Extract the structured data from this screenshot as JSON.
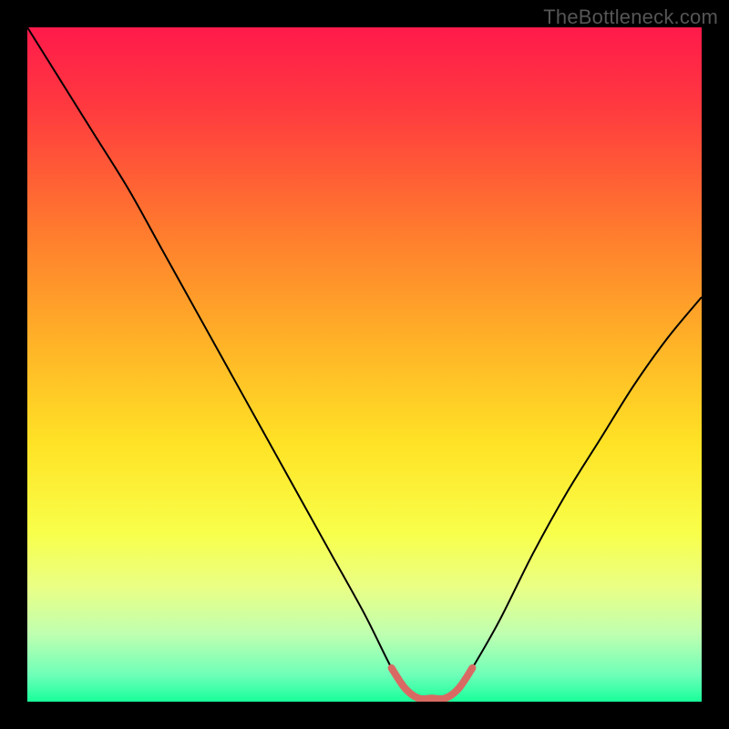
{
  "watermark": "TheBottleneck.com",
  "chart_data": {
    "type": "line",
    "title": "",
    "xlabel": "",
    "ylabel": "",
    "xlim": [
      0,
      100
    ],
    "ylim": [
      0,
      100
    ],
    "grid": false,
    "legend": false,
    "background_gradient": [
      {
        "stop": 0.0,
        "color": "#ff1a4b"
      },
      {
        "stop": 0.12,
        "color": "#ff3a3f"
      },
      {
        "stop": 0.3,
        "color": "#ff7a2e"
      },
      {
        "stop": 0.47,
        "color": "#ffb327"
      },
      {
        "stop": 0.62,
        "color": "#ffe326"
      },
      {
        "stop": 0.75,
        "color": "#f8ff4a"
      },
      {
        "stop": 0.83,
        "color": "#eaff85"
      },
      {
        "stop": 0.9,
        "color": "#bfffb0"
      },
      {
        "stop": 0.96,
        "color": "#6fffb8"
      },
      {
        "stop": 1.0,
        "color": "#18ff9a"
      }
    ],
    "series": [
      {
        "name": "bottleneck-curve",
        "stroke": "#000000",
        "stroke_width": 2,
        "x": [
          0,
          5,
          10,
          15,
          20,
          25,
          30,
          35,
          40,
          45,
          50,
          54,
          56,
          58,
          60,
          62,
          64,
          66,
          70,
          75,
          80,
          85,
          90,
          95,
          100
        ],
        "y": [
          100,
          92,
          84,
          76,
          67,
          58,
          49,
          40,
          31,
          22,
          13,
          5,
          2,
          0.5,
          0.5,
          0.5,
          2,
          5,
          12,
          22,
          31,
          39,
          47,
          54,
          60
        ]
      },
      {
        "name": "optimal-band",
        "stroke": "#d96a63",
        "stroke_width": 8,
        "linecap": "round",
        "x": [
          54,
          56,
          58,
          60,
          62,
          64,
          66
        ],
        "y": [
          5,
          2,
          0.5,
          0.5,
          0.5,
          2,
          5
        ]
      }
    ]
  }
}
